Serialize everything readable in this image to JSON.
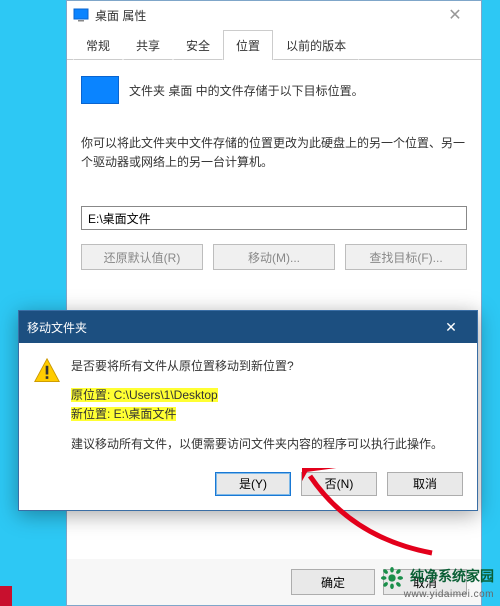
{
  "window": {
    "title": "桌面 属性",
    "close_glyph": "✕",
    "tabs": [
      "常规",
      "共享",
      "安全",
      "位置",
      "以前的版本"
    ],
    "active_tab_index": 3
  },
  "location_tab": {
    "line1": "文件夹 桌面 中的文件存储于以下目标位置。",
    "line2": "你可以将此文件夹中文件存储的位置更改为此硬盘上的另一个位置、另一个驱动器或网络上的另一台计算机。",
    "path_value": "E:\\桌面文件",
    "buttons": {
      "restore": "还原默认值(R)",
      "move": "移动(M)...",
      "find": "查找目标(F)..."
    }
  },
  "footer": {
    "ok": "确定",
    "cancel": "取消"
  },
  "dialog": {
    "title": "移动文件夹",
    "close_glyph": "✕",
    "question": "是否要将所有文件从原位置移动到新位置?",
    "old_label": "原位置: ",
    "old_path": "C:\\Users\\1\\Desktop",
    "new_label": "新位置: ",
    "new_path": "E:\\桌面文件",
    "advice": "建议移动所有文件，以便需要访问文件夹内容的程序可以执行此操作。",
    "yes": "是(Y)",
    "no": "否(N)",
    "cancel": "取消"
  },
  "watermark": {
    "line1": "纯净系统家园",
    "line2": "www.yidaimei.com"
  }
}
